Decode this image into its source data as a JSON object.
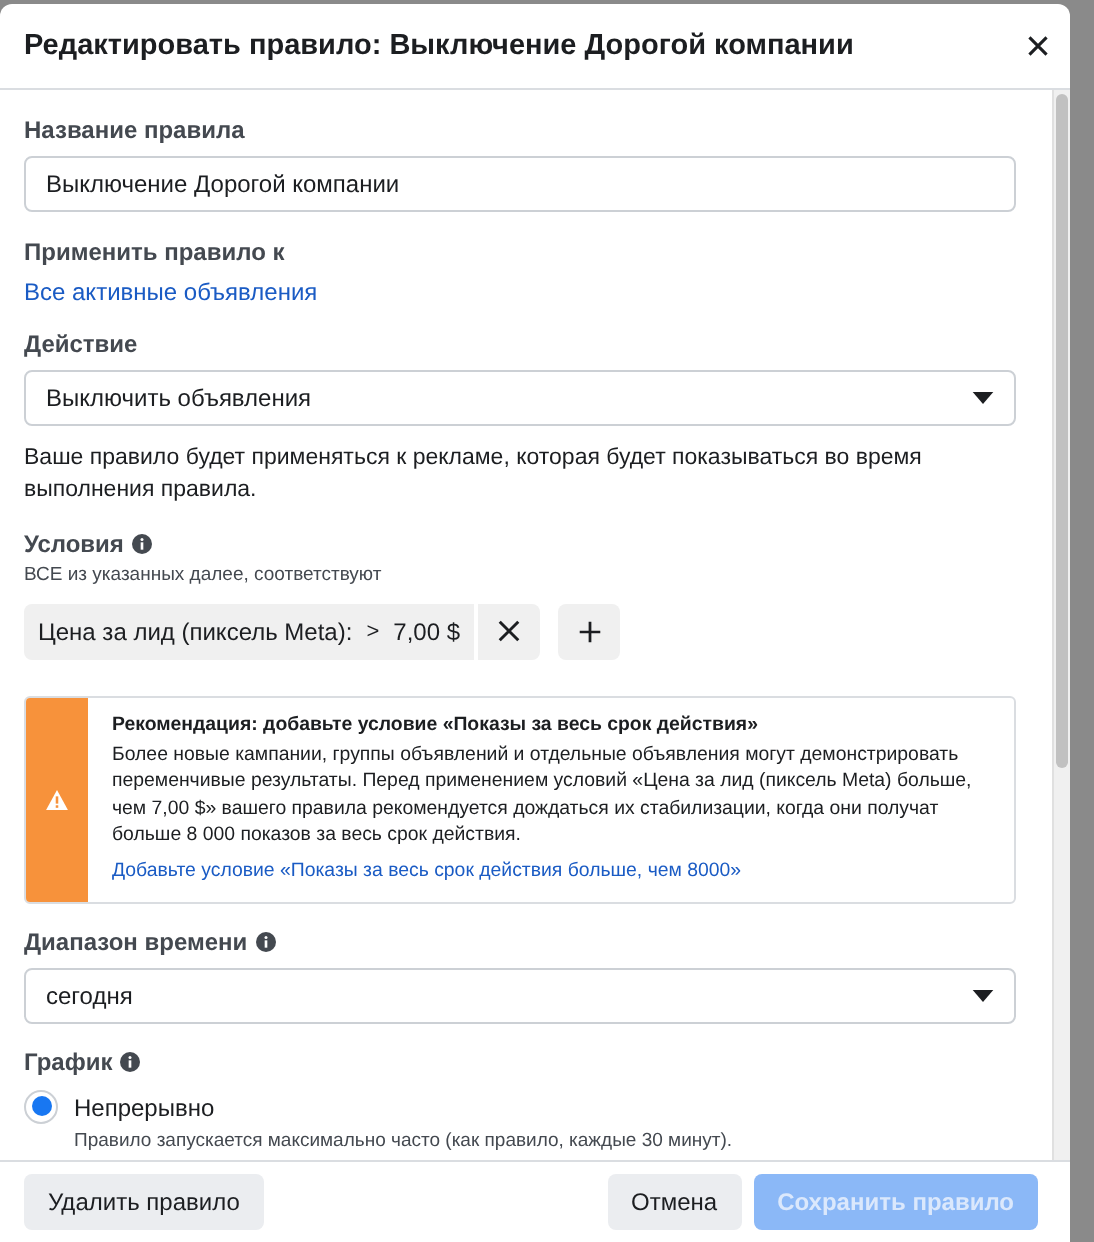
{
  "dialog": {
    "title": "Редактировать правило: Выключение Дорогой компании"
  },
  "rule_name": {
    "label": "Название правила",
    "value": "Выключение Дорогой компании"
  },
  "apply_to": {
    "label": "Применить правило к",
    "link": "Все активные объявления"
  },
  "action": {
    "label": "Действие",
    "value": "Выключить объявления",
    "note": "Ваше правило будет применяться к рекламе, которая будет показываться во время выполнения правила."
  },
  "conditions": {
    "label": "Условия",
    "subtitle": "ВСЕ из указанных далее, соответствуют",
    "items": [
      {
        "metric": "Цена за лид (пиксель Meta):",
        "operator": ">",
        "value": "7,00 $"
      }
    ]
  },
  "recommendation": {
    "title": "Рекомендация: добавьте условие «Показы за весь срок действия»",
    "text": "Более новые кампании, группы объявлений и отдельные объявления могут демонстрировать переменчивые результаты. Перед применением условий «Цена за лид (пиксель Meta) больше, чем 7,00 $» вашего правила рекомендуется дождаться их стабилизации, когда они получат больше 8 000 показов за весь срок действия.",
    "link": "Добавьте условие «Показы за весь срок действия больше, чем 8000»"
  },
  "time_range": {
    "label": "Диапазон времени",
    "value": "сегодня"
  },
  "schedule": {
    "label": "График",
    "options": [
      {
        "label": "Непрерывно",
        "description": "Правило запускается максимально часто (как правило, каждые 30 минут).",
        "selected": true
      }
    ]
  },
  "footer": {
    "buttons": [
      {
        "label": "Удалить правило",
        "kind": "secondary",
        "disabled": false
      },
      {
        "label": "Отмена",
        "kind": "secondary",
        "disabled": false
      },
      {
        "label": "Сохранить правило",
        "kind": "primary",
        "disabled": true
      }
    ]
  }
}
